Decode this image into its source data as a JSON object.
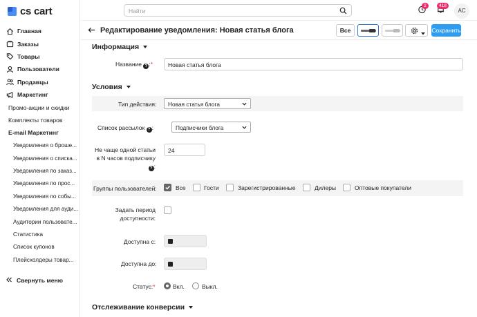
{
  "app": {
    "logo_text": "cs cart",
    "brand_color": "#4a8cf5"
  },
  "sidebar": {
    "main_items": [
      {
        "label": "Главная",
        "icon": "home-icon"
      },
      {
        "label": "Заказы",
        "icon": "orders-icon"
      },
      {
        "label": "Товары",
        "icon": "tag-icon"
      },
      {
        "label": "Пользователи",
        "icon": "user-icon"
      },
      {
        "label": "Продавцы",
        "icon": "sellers-icon"
      },
      {
        "label": "Маркетинг",
        "icon": "megaphone-icon"
      }
    ],
    "marketing_items": [
      "Промо-акции и скидки",
      "Комплекты товаров"
    ],
    "email_header": "E-mail Маркетинг",
    "email_items": [
      "Уведомления о броше...",
      "Уведомления о списка...",
      "Уведомления по заказ...",
      "Уведомления по прос...",
      "Уведомления по собы...",
      "Уведомления для ауди...",
      "Аудитории пользовате...",
      "Статистика",
      "Список купонов",
      "Плейсхолдеры товар..."
    ],
    "collapse_label": "Свернуть меню"
  },
  "topbar": {
    "search_placeholder": "Найти",
    "notif_count": "2",
    "messages_count": "418",
    "avatar_initials": "AC",
    "badge_color": "#e9306a"
  },
  "header": {
    "title": "Редактирование уведомления: Новая статья блога",
    "all_button": "Все",
    "save_button": "Сохранить",
    "save_color": "#2e9df1"
  },
  "form": {
    "info_section": "Информация",
    "name_label": "Название",
    "name_value": "Новая статья блога",
    "conditions_section": "Условия",
    "action_type_label": "Тип действия:",
    "action_type_value": "Новая статья блога",
    "mailing_list_label": "Список рассылок",
    "mailing_list_value": "Подписчики блога",
    "frequency_label_1": "Не чаще одной статьи",
    "frequency_label_2": "в N часов подписчику",
    "frequency_value": "24",
    "groups_label": "Группы пользователей:",
    "groups": [
      {
        "label": "Все",
        "checked": true
      },
      {
        "label": "Гости",
        "checked": false
      },
      {
        "label": "Зарегистрированные",
        "checked": false
      },
      {
        "label": "Дилеры",
        "checked": false
      },
      {
        "label": "Оптовые покупатели",
        "checked": false
      }
    ],
    "period_label_1": "Задать период",
    "period_label_2": "доступности:",
    "available_from_label": "Доступна с:",
    "available_to_label": "Доступна до:",
    "status_label": "Статус:",
    "status_on": "Вкл.",
    "status_off": "Выкл.",
    "status_selected": "Вкл.",
    "conversion_section": "Отслеживание конверсии"
  }
}
